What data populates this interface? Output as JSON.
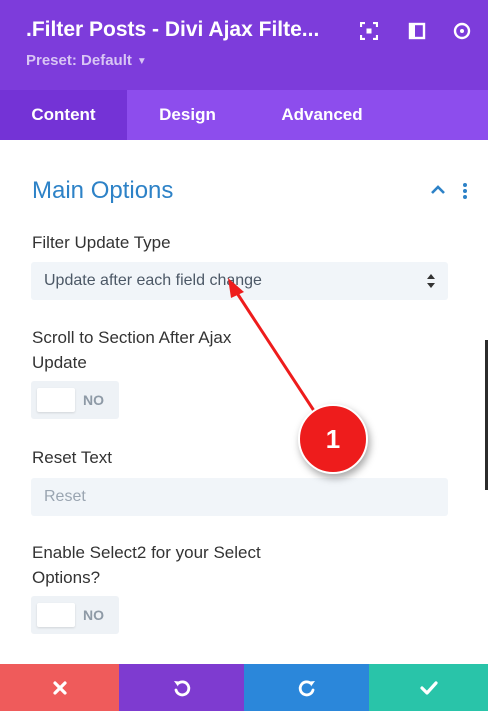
{
  "header": {
    "title": ".Filter Posts - Divi Ajax Filte...",
    "preset": "Preset: Default",
    "icons": [
      "focus-icon",
      "sidebar-layout-icon",
      "more-icon"
    ]
  },
  "tabs": [
    {
      "label": "Content",
      "active": true
    },
    {
      "label": "Design",
      "active": false
    },
    {
      "label": "Advanced",
      "active": false
    }
  ],
  "section": {
    "title": "Main Options",
    "expanded": true
  },
  "fields": {
    "filter_update_type": {
      "label": "Filter Update Type",
      "value": "Update after each field change"
    },
    "scroll_to_section": {
      "label_line1": "Scroll to Section After Ajax",
      "label_line2": "Update",
      "state": "NO"
    },
    "reset_text": {
      "label": "Reset Text",
      "placeholder": "Reset"
    },
    "enable_select2": {
      "label_line1": "Enable Select2 for your Select",
      "label_line2": "Options?",
      "state": "NO"
    }
  },
  "annotation": {
    "number": "1",
    "color": "#ee1c1c"
  },
  "footer": {
    "buttons": [
      {
        "name": "cancel",
        "icon": "close-icon",
        "color": "#ef5b5b"
      },
      {
        "name": "undo",
        "icon": "undo-icon",
        "color": "#7e3bd0"
      },
      {
        "name": "redo",
        "icon": "redo-icon",
        "color": "#2b87da"
      },
      {
        "name": "save",
        "icon": "check-icon",
        "color": "#29c4a9"
      }
    ]
  },
  "colors": {
    "header_bg": "#7d3cdb",
    "tabs_bg": "#8d4ded",
    "active_tab_bg": "#7433d6",
    "section_title": "#2d82c7"
  }
}
